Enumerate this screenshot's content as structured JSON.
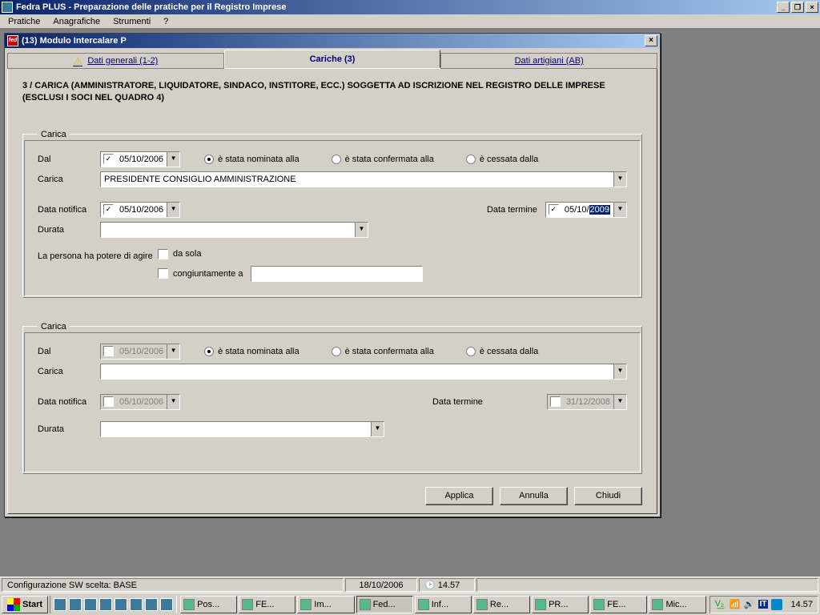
{
  "app": {
    "title": "Fedra PLUS  -  Preparazione delle pratiche per il Registro Imprese",
    "menu": {
      "pratiche": "Pratiche",
      "anagrafiche": "Anagrafiche",
      "strumenti": "Strumenti",
      "help": "?"
    }
  },
  "inner": {
    "title": "(13) Modulo Intercalare P",
    "tabs": {
      "t1": "Dati generali (1-2)",
      "t2": "Cariche (3)",
      "t3": "Dati artigiani (AB)"
    }
  },
  "heading": "3 / CARICA (AMMINISTRATORE, LIQUIDATORE, SINDACO, INSTITORE, ECC.) SOGGETTA AD ISCRIZIONE NEL REGISTRO DELLE IMPRESE (ESCLUSI I SOCI NEL QUADRO 4)",
  "labels": {
    "carica": "Carica",
    "dal": "Dal",
    "datanotifica": "Data notifica",
    "datatermine": "Data termine",
    "durata": "Durata",
    "persona": "La persona ha potere di agire",
    "dasola": "da sola",
    "congiuntamente": "congiuntamente a"
  },
  "radios": {
    "nominata": "è stata nominata alla",
    "confermata": "è stata confermata alla",
    "cessata": "è cessata dalla"
  },
  "g1": {
    "dal": "05/10/2006",
    "carica": "PRESIDENTE CONSIGLIO AMMINISTRAZIONE",
    "datanotifica": "05/10/2006",
    "datatermine_pre": "05/10/",
    "datatermine_sel": "2009",
    "durata": "",
    "congiuntamente_val": ""
  },
  "g2": {
    "dal": "05/10/2006",
    "carica": "",
    "datanotifica": "05/10/2006",
    "datatermine": "31/12/2008",
    "durata": ""
  },
  "buttons": {
    "applica": "Applica",
    "annulla": "Annulla",
    "chiudi": "Chiudi"
  },
  "statusbar": {
    "config": "Configurazione SW scelta: BASE",
    "date": "18/10/2006",
    "time": "14.57"
  },
  "taskbar": {
    "start": "Start",
    "tasks": [
      "Pos...",
      "FE...",
      "Im...",
      "Fed...",
      "Inf...",
      "Re...",
      "PR...",
      "FE...",
      "Mic..."
    ],
    "active_index": 3,
    "lang": "IT",
    "clock": "14.57"
  }
}
